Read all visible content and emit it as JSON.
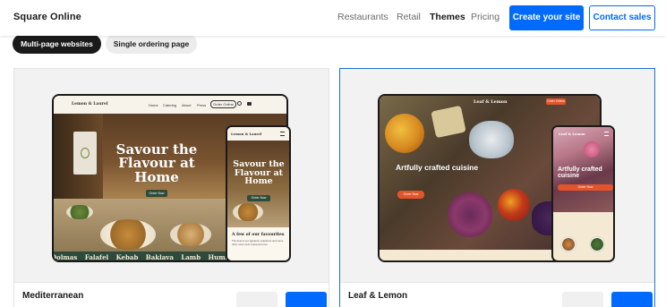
{
  "header": {
    "brand": "Square Online",
    "nav": [
      "Restaurants",
      "Retail",
      "Themes",
      "Pricing"
    ],
    "active_nav": "Themes",
    "create_button": "Create your site",
    "contact_button": "Contact sales"
  },
  "filters": {
    "multi": "Multi-page websites",
    "single": "Single ordering page"
  },
  "cards": [
    {
      "title": "Mediterranean",
      "preview": {
        "logo": "Lemon & Laurel",
        "nav": [
          "Home",
          "Catering",
          "About",
          "Press"
        ],
        "order_button": "Order Online",
        "hero": "Savour the Flavour at Home",
        "hero_button": "Order Now",
        "mobile_logo": "Lemon & Laurel",
        "mobile_hero": "Savour the Flavour at Home",
        "mobile_button": "Order Now",
        "mobile_section_title": "A few of our favourites",
        "mobile_section_text": "The best of our signature selections and some other ones most customers love",
        "marquee": [
          "Dolmas",
          "Falafel",
          "Kebab",
          "Baklava",
          "Lamb",
          "Hummus"
        ]
      }
    },
    {
      "title": "Leaf & Lemon",
      "preview": {
        "logo": "Leaf & Lemon",
        "order_button": "Order Online",
        "hero": "Artfully crafted cuisine",
        "hero_button": "Order Now",
        "mobile_logo": "Leaf & Lemon",
        "mobile_hero": "Artfully crafted cuisine",
        "mobile_button": "Order Now"
      }
    }
  ],
  "colors": {
    "accent": "#006aff",
    "selected_border": "#1f6fd6",
    "mediterranean_green": "#2e4a3a",
    "leaf_orange": "#e2542b"
  }
}
